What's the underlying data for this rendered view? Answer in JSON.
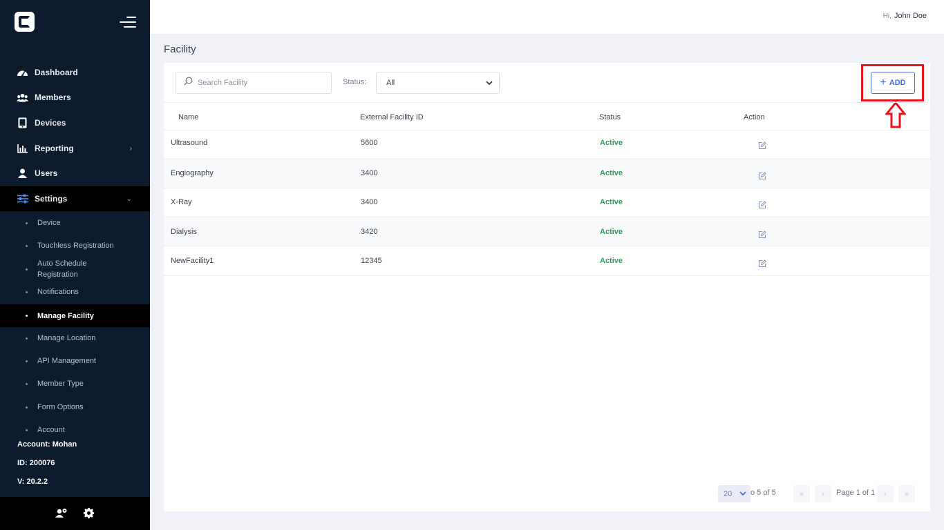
{
  "sidebar": {
    "nav": [
      {
        "label": "Dashboard",
        "icon": "dashboard-icon"
      },
      {
        "label": "Members",
        "icon": "members-icon"
      },
      {
        "label": "Devices",
        "icon": "tablet-icon"
      },
      {
        "label": "Reporting",
        "icon": "bar-chart-icon"
      },
      {
        "label": "Users",
        "icon": "user-icon"
      },
      {
        "label": "Settings",
        "icon": "sliders-icon"
      }
    ],
    "sub": [
      {
        "label": "Device"
      },
      {
        "label": "Touchless Registration"
      },
      {
        "label": "Auto Schedule Registration"
      },
      {
        "label": "Notifications"
      },
      {
        "label": "Manage Facility"
      },
      {
        "label": "Manage Location"
      },
      {
        "label": "API Management"
      },
      {
        "label": "Member Type"
      },
      {
        "label": "Form Options"
      },
      {
        "label": "Account"
      }
    ],
    "account": {
      "account_line": "Account: Mohan",
      "id_line": "ID: 200076",
      "version_line": "V: 20.2.2"
    }
  },
  "header": {
    "greeting": "Hi,",
    "user_name": "John Doe"
  },
  "page": {
    "title": "Facility"
  },
  "toolbar": {
    "search_placeholder": "Search Facility",
    "status_label": "Status:",
    "status_value": "All",
    "add_label": "ADD"
  },
  "table": {
    "columns": [
      "Name",
      "External Facility ID",
      "Status",
      "Action"
    ],
    "rows": [
      {
        "name": "Ultrasound",
        "external_id": "5600",
        "status": "Active"
      },
      {
        "name": "Engiography",
        "external_id": "3400",
        "status": "Active"
      },
      {
        "name": "X-Ray",
        "external_id": "3400",
        "status": "Active"
      },
      {
        "name": "Dialysis",
        "external_id": "3420",
        "status": "Active"
      },
      {
        "name": "NewFacility1",
        "external_id": "12345",
        "status": "Active"
      }
    ]
  },
  "pagination": {
    "page_size": "20",
    "range_text": "o 5 of 5",
    "page_info": "Page 1 of 1",
    "first": "«",
    "prev": "‹",
    "next": "›",
    "last": "»"
  },
  "colors": {
    "sidebar_bg": "#0c1c2e",
    "accent": "#4a6ad6",
    "active_status": "#2f9a55",
    "highlight": "#e8141f"
  }
}
